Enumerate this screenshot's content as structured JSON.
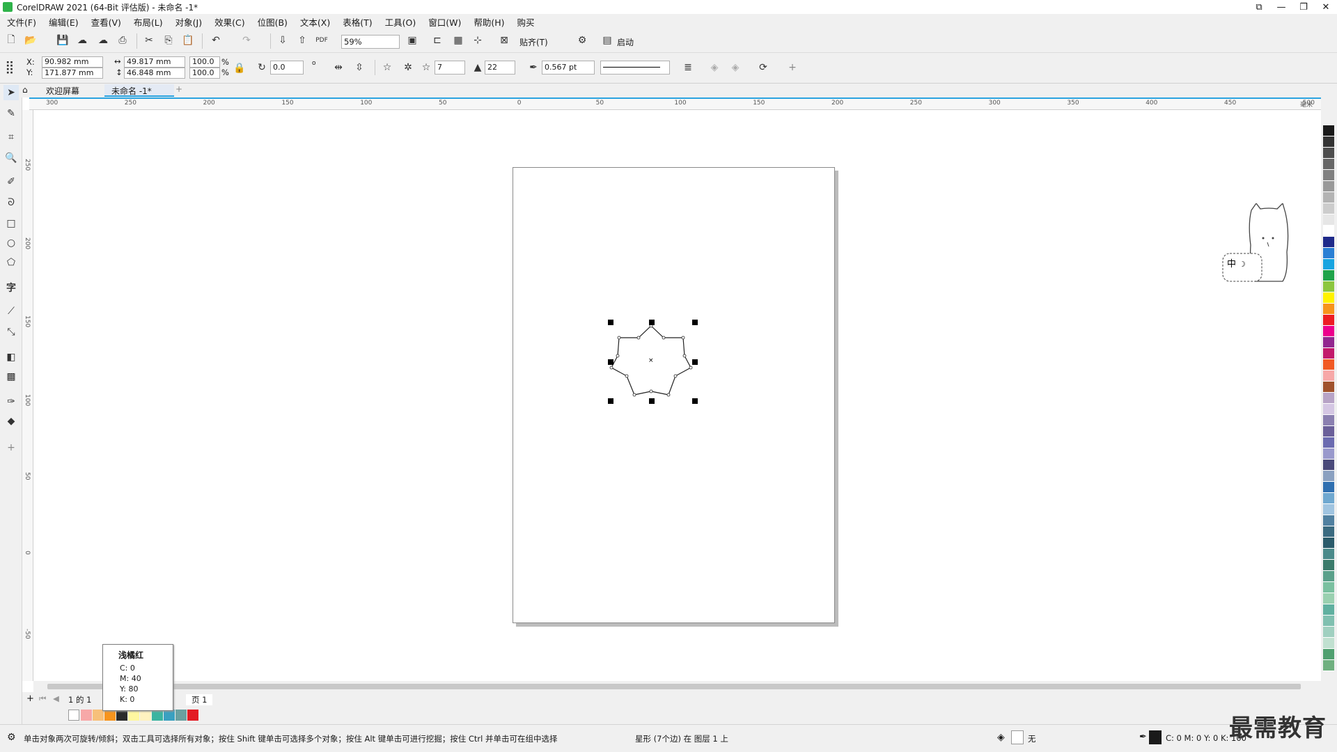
{
  "app": {
    "title": "CorelDRAW 2021 (64-Bit 评估版) - 未命名 -1*"
  },
  "menu": [
    "文件(F)",
    "编辑(E)",
    "查看(V)",
    "布局(L)",
    "对象(J)",
    "效果(C)",
    "位图(B)",
    "文本(X)",
    "表格(T)",
    "工具(O)",
    "窗口(W)",
    "帮助(H)",
    "购买"
  ],
  "toolbar": {
    "zoom_value": "59%",
    "snap_label": "贴齐(T)",
    "launch_label": "启动"
  },
  "property_bar": {
    "x_label": "X:",
    "y_label": "Y:",
    "x_value": "90.982 mm",
    "y_value": "171.877 mm",
    "width_value": "49.817 mm",
    "height_value": "46.848 mm",
    "scale_w": "100.0",
    "scale_h": "100.0",
    "percent": "%",
    "rotation": "0.0",
    "degree": "o",
    "points": "7",
    "sharpness": "22",
    "outline_width": "0.567 pt"
  },
  "tabs": {
    "welcome": "欢迎屏幕",
    "document": "未命名 -1*"
  },
  "ruler_h": [
    "300",
    "250",
    "200",
    "150",
    "100",
    "50",
    "0",
    "50",
    "100",
    "150",
    "200",
    "250",
    "300",
    "350",
    "400",
    "450",
    "500"
  ],
  "ruler_h_unit": "毫米",
  "ruler_v": [
    "250",
    "200",
    "150",
    "100",
    "50",
    "0",
    "-50"
  ],
  "pagebar": {
    "page_counter": "1 的 1",
    "page_tab": "页 1"
  },
  "tooltip": {
    "name": "浅橘红",
    "c": "C:   0",
    "m": "M:   40",
    "y": "Y:   80",
    "k": "K:   0"
  },
  "status": {
    "hint": "单击对象两次可旋转/倾斜；双击工具可选择所有对象；按住 Shift 键单击可选择多个对象；按住 Alt 键单击可进行挖掘；按住 Ctrl 并单击可在组中选择",
    "selection": "星形 (7个边) 在 图层 1 上",
    "fill_label": "无",
    "outline_readout": "C: 0 M: 0 Y: 0 K: 100"
  },
  "watermark": "最需教育",
  "colors": {
    "accent": "#2aa3e0",
    "logo": "#2fb34a",
    "palette": [
      "#1a1a1a",
      "#333333",
      "#4d4d4d",
      "#666666",
      "#808080",
      "#999999",
      "#b3b3b3",
      "#cccccc",
      "#e6e6e6",
      "#ffffff",
      "#1f2a8a",
      "#2a7fd4",
      "#18a4e0",
      "#1fa34a",
      "#8cc63f",
      "#fff200",
      "#f7941d",
      "#ed1c24",
      "#ec008c",
      "#92278f",
      "#c21a6b",
      "#f15a24",
      "#f7a8a8",
      "#a0522d",
      "#b7a3c6",
      "#d4c6e3",
      "#8a7fb0",
      "#6a5f99",
      "#6b6bb0",
      "#9999cc",
      "#4a4a7a",
      "#8aa0c0",
      "#2f6fb0",
      "#6fa8d0",
      "#a0c4e0",
      "#5080a0",
      "#3a6a80",
      "#2a5a6a",
      "#4a8a8a",
      "#3a7a6a",
      "#5aa08a",
      "#7ac0a0",
      "#9ad0b0",
      "#60b0a0",
      "#80c0b0",
      "#a0d0c0",
      "#c0e0d0",
      "#50a070",
      "#70b080"
    ],
    "doc_palette": [
      "#f7a8a8",
      "#f7c07a",
      "#f7941d",
      "#2b2b2b",
      "#fff7a0",
      "#fff2c0",
      "#3cb4a0",
      "#3aa0c0",
      "#6aa0a0",
      "#e31c24"
    ]
  }
}
